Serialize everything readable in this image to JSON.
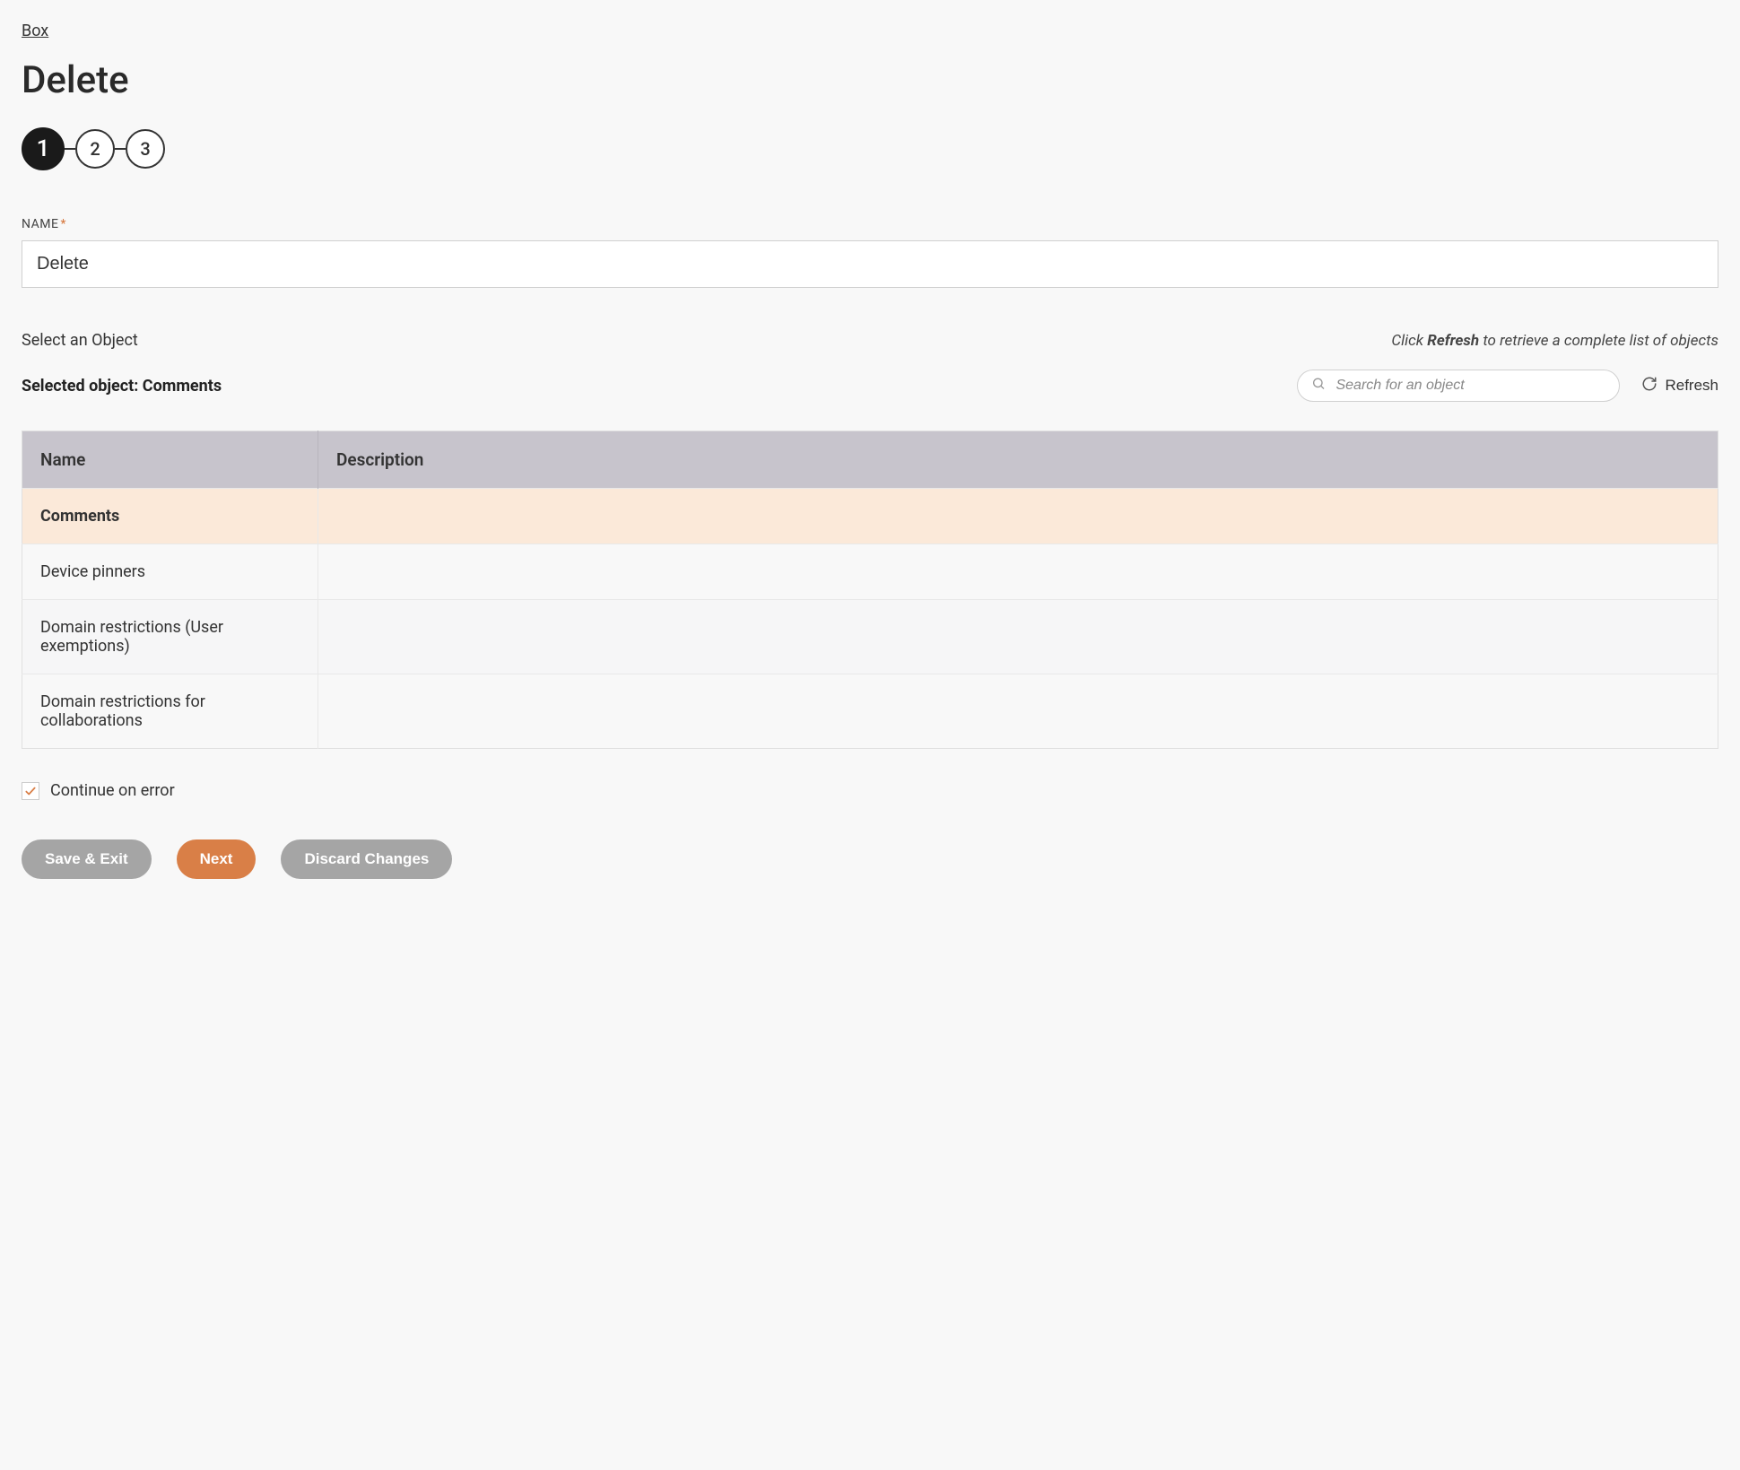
{
  "breadcrumb": {
    "label": "Box"
  },
  "page_title": "Delete",
  "stepper": {
    "steps": [
      "1",
      "2",
      "3"
    ],
    "active_index": 0
  },
  "name_field": {
    "label": "NAME",
    "required_mark": "*",
    "value": "Delete"
  },
  "object_section": {
    "label": "Select an Object",
    "hint_prefix": "Click ",
    "hint_bold": "Refresh",
    "hint_suffix": " to retrieve a complete list of objects",
    "selected_prefix": "Selected object: ",
    "selected_value": "Comments",
    "search_placeholder": "Search for an object",
    "refresh_label": "Refresh"
  },
  "table": {
    "columns": [
      "Name",
      "Description"
    ],
    "rows": [
      {
        "name": "Comments",
        "description": "",
        "selected": true
      },
      {
        "name": "Device pinners",
        "description": "",
        "selected": false
      },
      {
        "name": "Domain restrictions (User exemptions)",
        "description": "",
        "selected": false
      },
      {
        "name": "Domain restrictions for collaborations",
        "description": "",
        "selected": false
      }
    ]
  },
  "continue_on_error": {
    "label": "Continue on error",
    "checked": true
  },
  "buttons": {
    "save_exit": "Save & Exit",
    "next": "Next",
    "discard": "Discard Changes"
  },
  "colors": {
    "accent": "#d97f47",
    "step_active": "#1a1a1a",
    "selected_row": "#fbe9d9",
    "table_header": "#c7c4cc"
  }
}
